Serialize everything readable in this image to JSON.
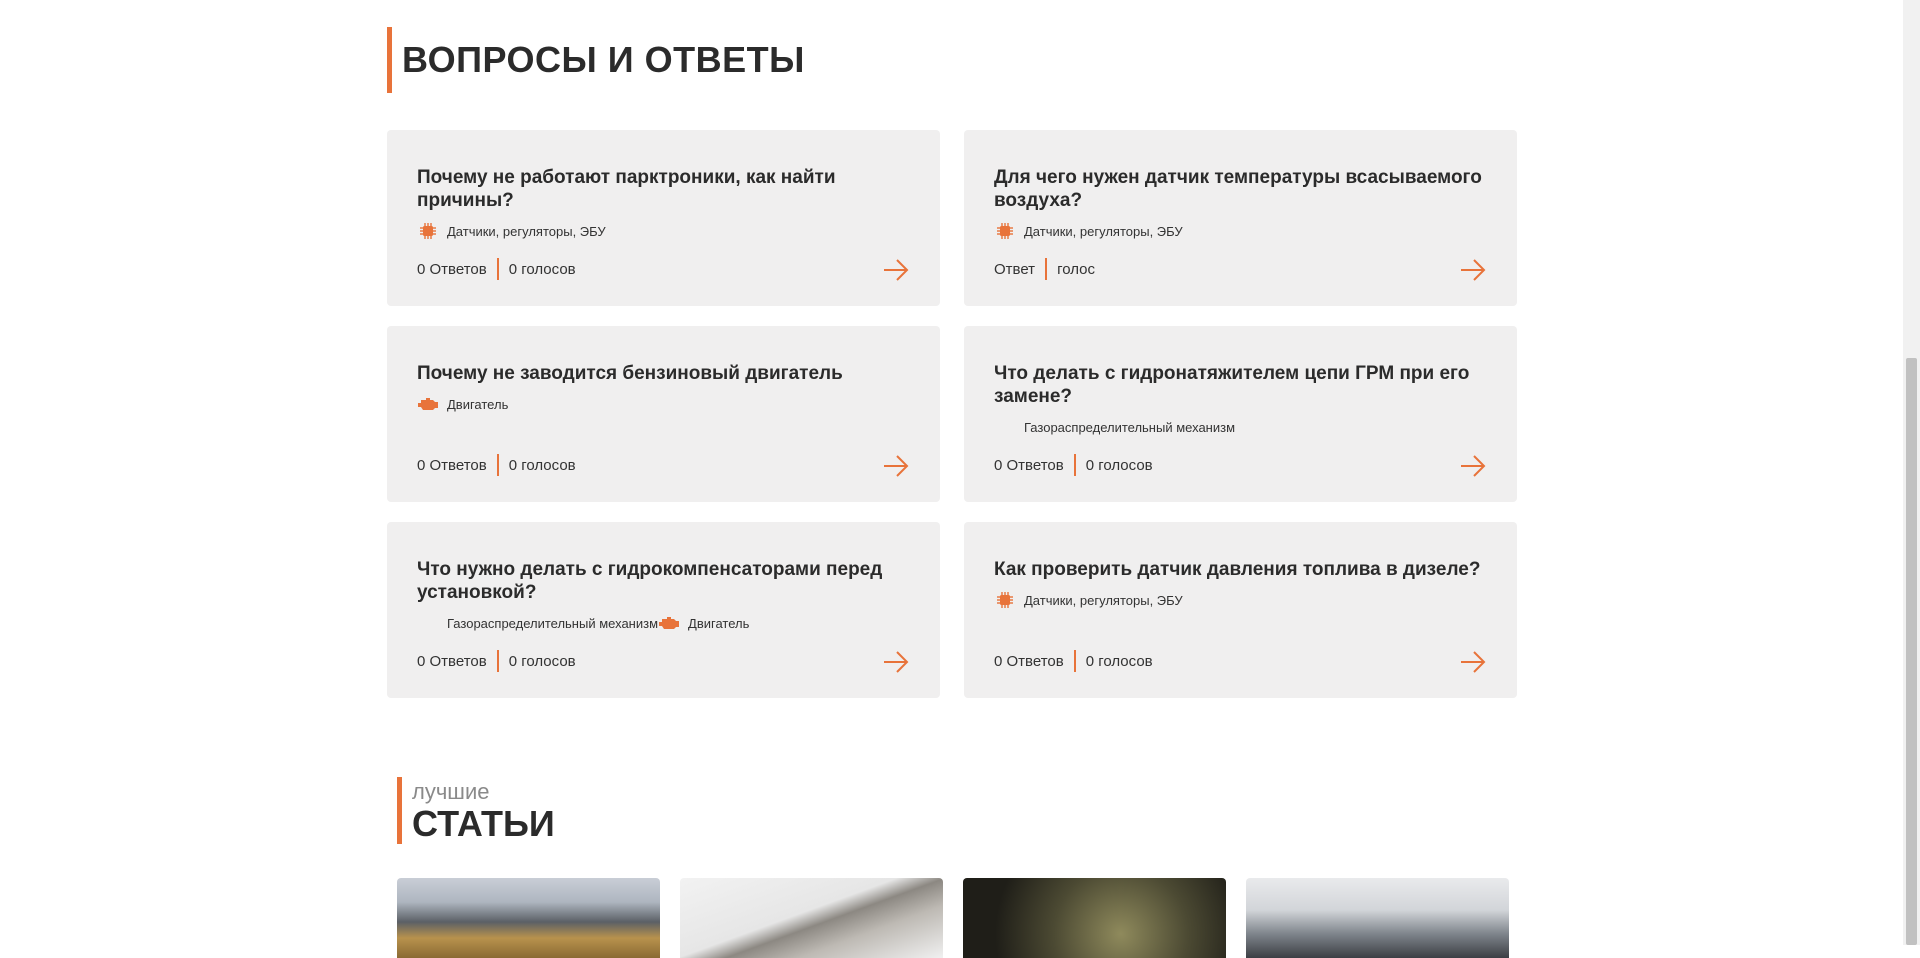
{
  "faq": {
    "title": "ВОПРОСЫ И ОТВЕТЫ",
    "cards": [
      {
        "question": "Почему не работают парктроники, как найти причины?",
        "categories": [
          {
            "label": "Датчики, регуляторы, ЭБУ",
            "icon": "chip-icon"
          }
        ],
        "answers": "0 Ответов",
        "votes": "0 голосов"
      },
      {
        "question": "Для чего нужен датчик температуры всасываемого воздуха?",
        "categories": [
          {
            "label": "Датчики, регуляторы, ЭБУ",
            "icon": "chip-icon"
          }
        ],
        "answers": "Ответ",
        "votes": "голос"
      },
      {
        "question": "Почему не заводится бензиновый двигатель",
        "categories": [
          {
            "label": "Двигатель",
            "icon": "engine-icon"
          }
        ],
        "answers": "0 Ответов",
        "votes": "0 голосов"
      },
      {
        "question": "Что делать с гидронатяжителем цепи ГРМ при его замене?",
        "categories": [
          {
            "label": "Газораспределительный механизм",
            "icon": "none"
          }
        ],
        "answers": "0 Ответов",
        "votes": "0 голосов"
      },
      {
        "question": "Что нужно делать с гидрокомпенсаторами перед установкой?",
        "categories": [
          {
            "label": "Газораспределительный механизм",
            "icon": "none"
          },
          {
            "label": "Двигатель",
            "icon": "engine-icon"
          }
        ],
        "answers": "0 Ответов",
        "votes": "0 голосов"
      },
      {
        "question": "Как проверить датчик давления топлива в дизеле?",
        "categories": [
          {
            "label": "Датчики, регуляторы, ЭБУ",
            "icon": "chip-icon"
          }
        ],
        "answers": "0 Ответов",
        "votes": "0 голосов"
      }
    ]
  },
  "articles": {
    "subtitle": "лучшие",
    "title": "СТАТЬИ"
  },
  "colors": {
    "accent": "#e8733a",
    "card_bg": "#f0efef"
  }
}
